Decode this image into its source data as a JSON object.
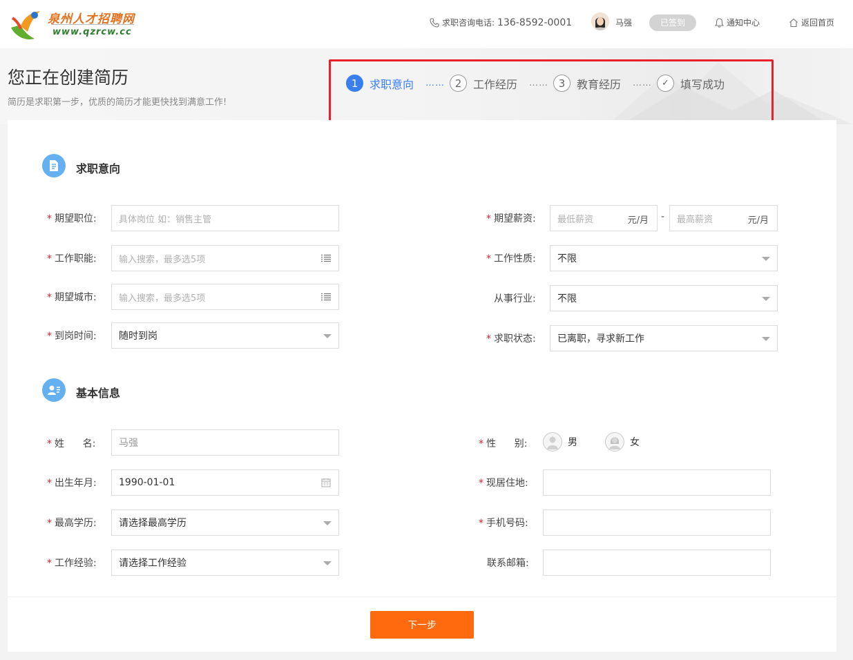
{
  "header": {
    "logo_cn": "泉州人才招聘网",
    "logo_url": "www.qzrcw.cc",
    "hotline_label": "求职咨询电话:",
    "hotline_number": "136-8592-0001",
    "user_name": "马强",
    "signed_label": "已签到",
    "notify_label": "通知中心",
    "home_label": "返回首页"
  },
  "page": {
    "title": "您正在创建简历",
    "subtitle": "简历是求职第一步，优质的简历才能更快找到满意工作!"
  },
  "steps": [
    {
      "num": "1",
      "label": "求职意向",
      "active": true
    },
    {
      "num": "2",
      "label": "工作经历",
      "active": false
    },
    {
      "num": "3",
      "label": "教育经历",
      "active": false
    },
    {
      "num": "✓",
      "label": "填写成功",
      "active": false
    }
  ],
  "steps_dots": "……",
  "intent": {
    "title": "求职意向",
    "position_label": "期望职位:",
    "position_placeholder": "具体岗位 如：销售主管",
    "function_label": "工作职能:",
    "function_placeholder": "输入搜索，最多选5项",
    "city_label": "期望城市:",
    "city_placeholder": "输入搜索，最多选5项",
    "arrival_label": "到岗时间:",
    "arrival_value": "随时到岗",
    "salary_label": "期望薪资:",
    "salary_min_placeholder": "最低薪资",
    "salary_max_placeholder": "最高薪资",
    "salary_unit": "元/月",
    "salary_dash": "-",
    "nature_label": "工作性质:",
    "nature_value": "不限",
    "industry_label": "从事行业:",
    "industry_value": "不限",
    "status_label": "求职状态:",
    "status_value": "已离职，寻求新工作"
  },
  "basic": {
    "title": "基本信息",
    "name_label": "姓      名:",
    "name_value": "马强",
    "birth_label": "出生年月:",
    "birth_value": "1990-01-01",
    "edu_label": "最高学历:",
    "edu_value": "请选择最高学历",
    "exp_label": "工作经验:",
    "exp_value": "请选择工作经验",
    "gender_label": "性      别:",
    "gender_male": "男",
    "gender_female": "女",
    "residence_label": "现居住地:",
    "residence_value": "",
    "phone_label": "手机号码:",
    "phone_value": "",
    "email_label": "联系邮箱:",
    "email_value": ""
  },
  "next_label": "下一步",
  "colors": {
    "accent": "#3a7ff0",
    "primary_button": "#ff6a0e",
    "required": "#e8202a",
    "section_icon": "#64b0f0",
    "highlight_border": "#e8202a"
  }
}
